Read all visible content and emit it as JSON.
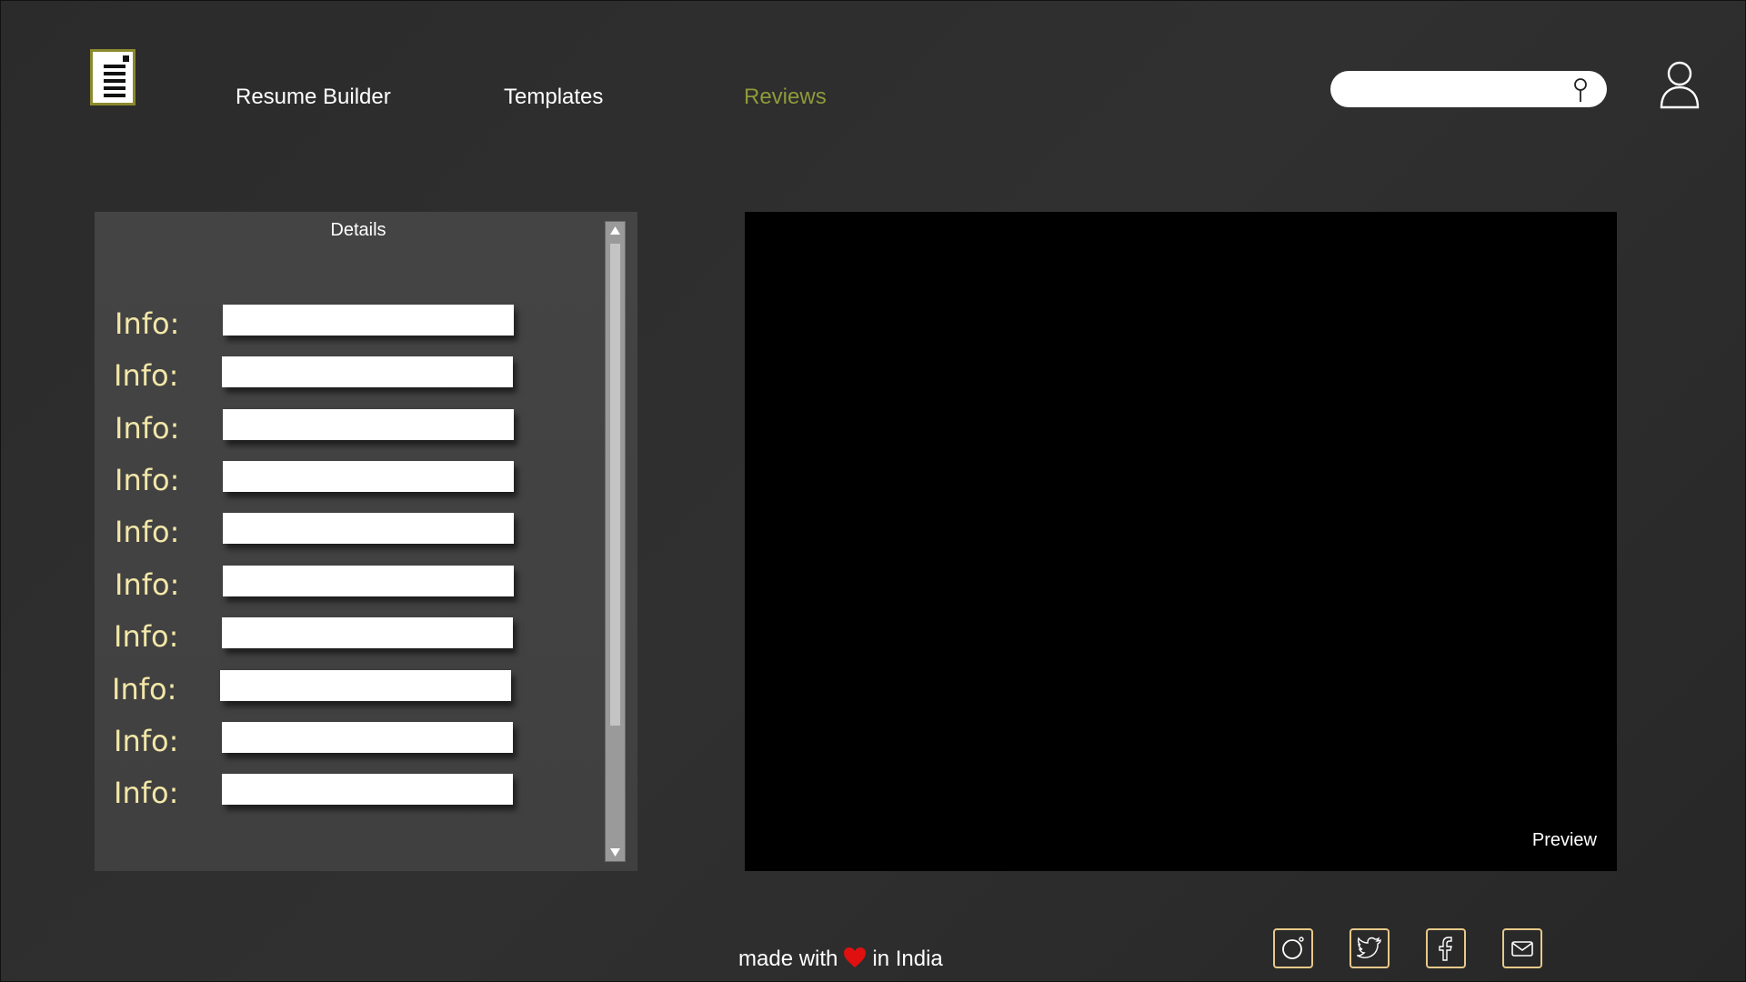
{
  "nav": {
    "items": [
      {
        "label": "Resume Builder"
      },
      {
        "label": "Templates"
      },
      {
        "label": "Reviews"
      }
    ],
    "active_color": "#8f9a3a"
  },
  "search": {
    "placeholder": ""
  },
  "details": {
    "title": "Details",
    "rows": [
      {
        "label": "Info:",
        "value": ""
      },
      {
        "label": "Info:",
        "value": ""
      },
      {
        "label": "Info:",
        "value": ""
      },
      {
        "label": "Info:",
        "value": ""
      },
      {
        "label": "Info:",
        "value": ""
      },
      {
        "label": "Info:",
        "value": ""
      },
      {
        "label": "Info:",
        "value": ""
      },
      {
        "label": "Info:",
        "value": ""
      },
      {
        "label": "Info:",
        "value": ""
      },
      {
        "label": "Info:",
        "value": ""
      }
    ]
  },
  "preview": {
    "label": "Preview"
  },
  "footer": {
    "made_with": "made with",
    "in_country": "in India",
    "heart_color": "#e01010",
    "social": [
      "instagram-icon",
      "twitter-icon",
      "facebook-icon",
      "mail-icon"
    ]
  }
}
